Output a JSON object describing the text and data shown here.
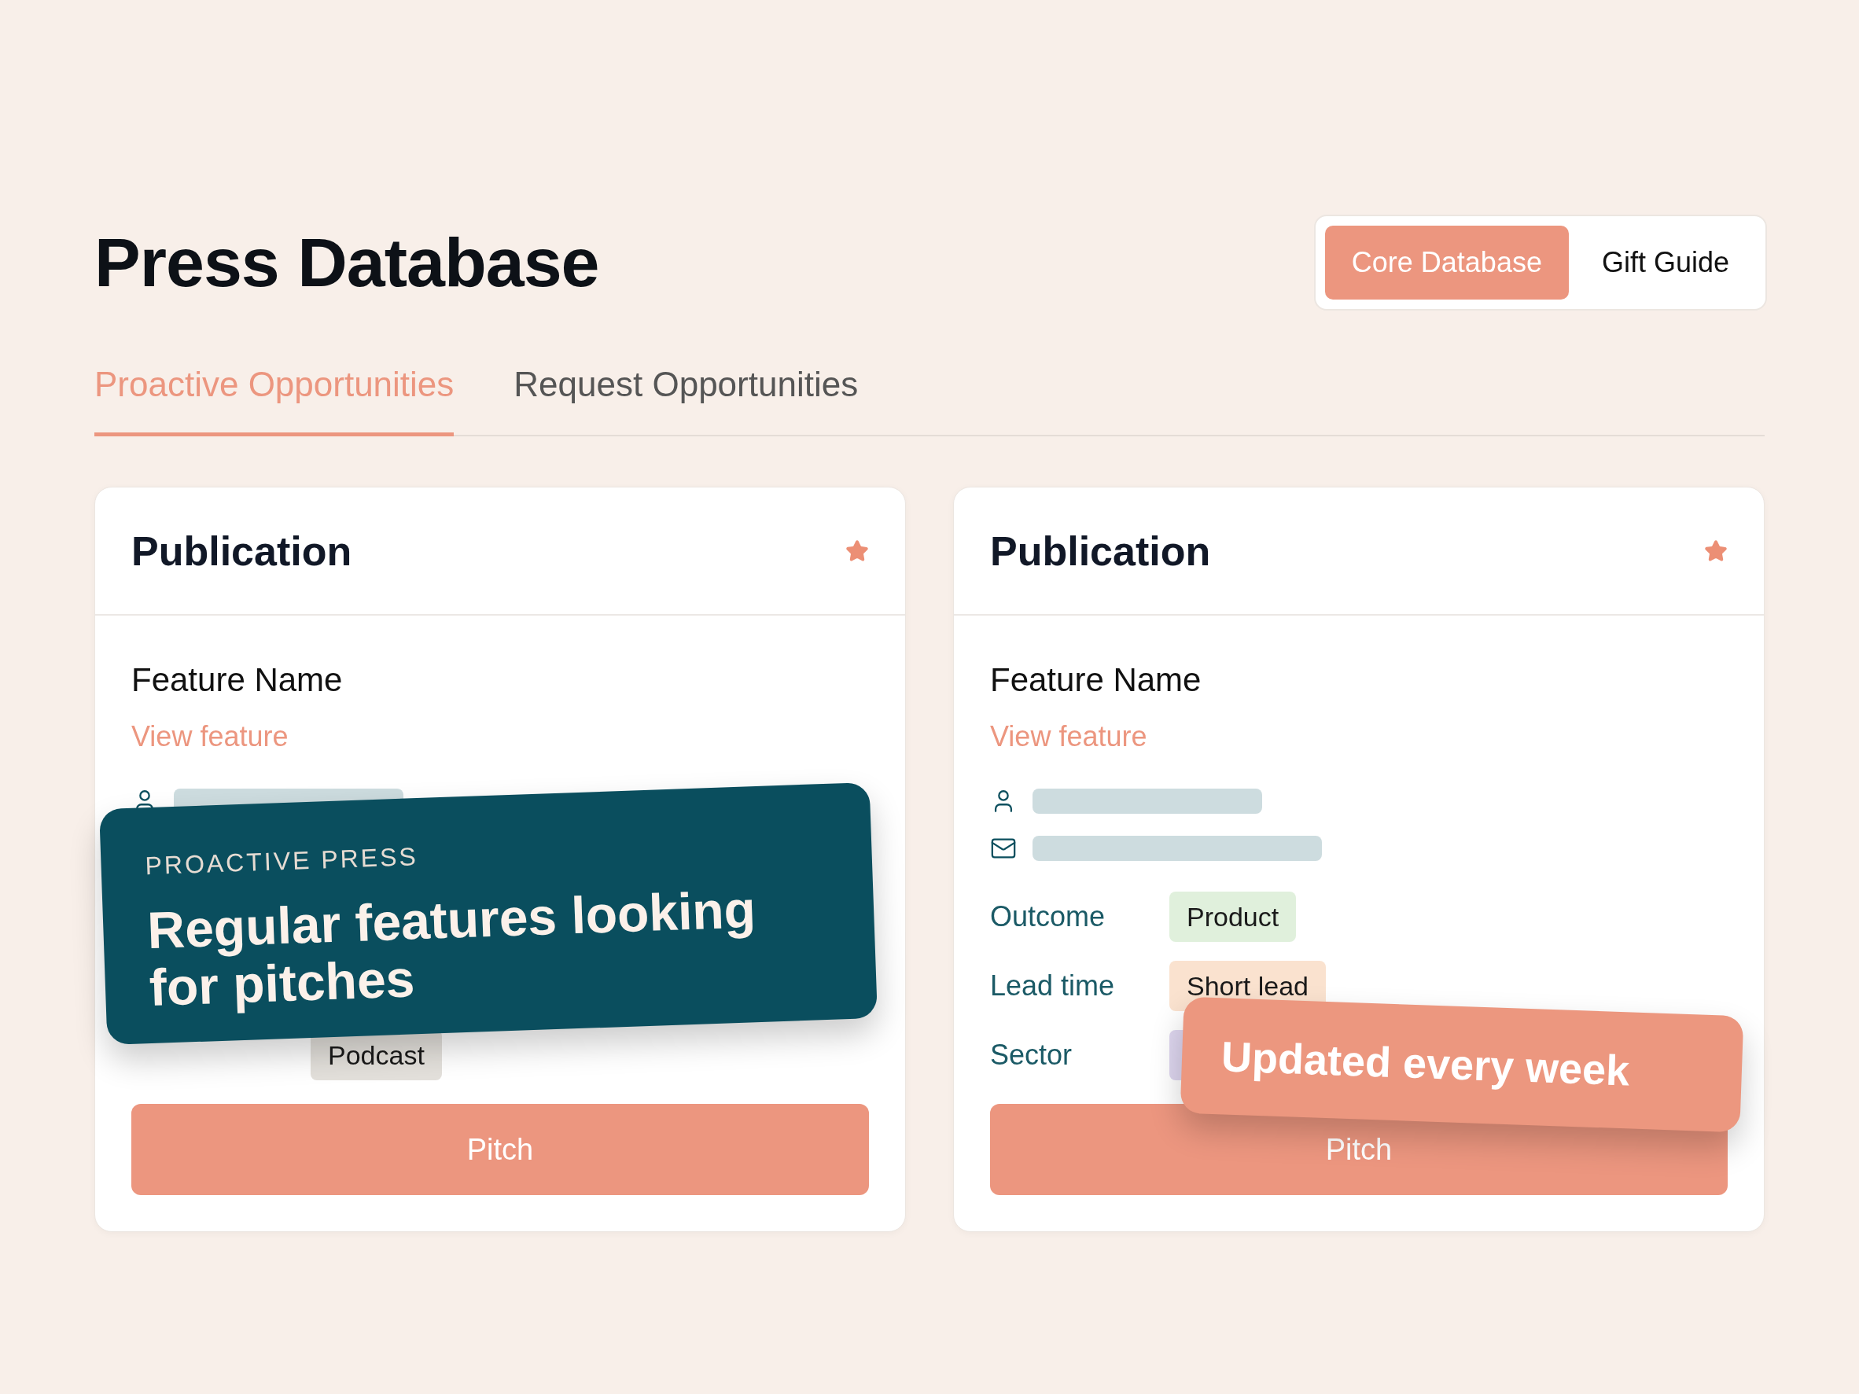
{
  "title": "Press Database",
  "segments": [
    {
      "label": "Core Database",
      "selected": true
    },
    {
      "label": "Gift Guide",
      "selected": false
    }
  ],
  "tabs": [
    {
      "label": "Proactive Opportunities",
      "selected": true
    },
    {
      "label": "Request Opportunities",
      "selected": false
    }
  ],
  "cards": [
    {
      "title": "Publication",
      "starred": true,
      "feature_name": "Feature Name",
      "link": "View feature",
      "contacts": [
        {
          "kind": "person"
        }
      ],
      "fields": [
        {
          "value": "Podcast",
          "color": "#e3e0db"
        }
      ],
      "button": "Pitch",
      "overlay": {
        "kind": "dark",
        "eyebrow": "PROACTIVE PRESS",
        "text": "Regular features looking for pitches"
      }
    },
    {
      "title": "Publication",
      "starred": true,
      "feature_name": "Feature Name",
      "link": "View feature",
      "contacts": [
        {
          "kind": "person"
        },
        {
          "kind": "email"
        }
      ],
      "fields": [
        {
          "label": "Outcome",
          "value": "Product",
          "color": "#e0f0dc"
        },
        {
          "label": "Lead time",
          "value": "Short lead",
          "color": "#fae2cf"
        },
        {
          "label": "Sector",
          "color": "#ddd5ee"
        }
      ],
      "button": "Pitch",
      "overlay": {
        "kind": "accent",
        "text": "Updated every week"
      }
    }
  ]
}
